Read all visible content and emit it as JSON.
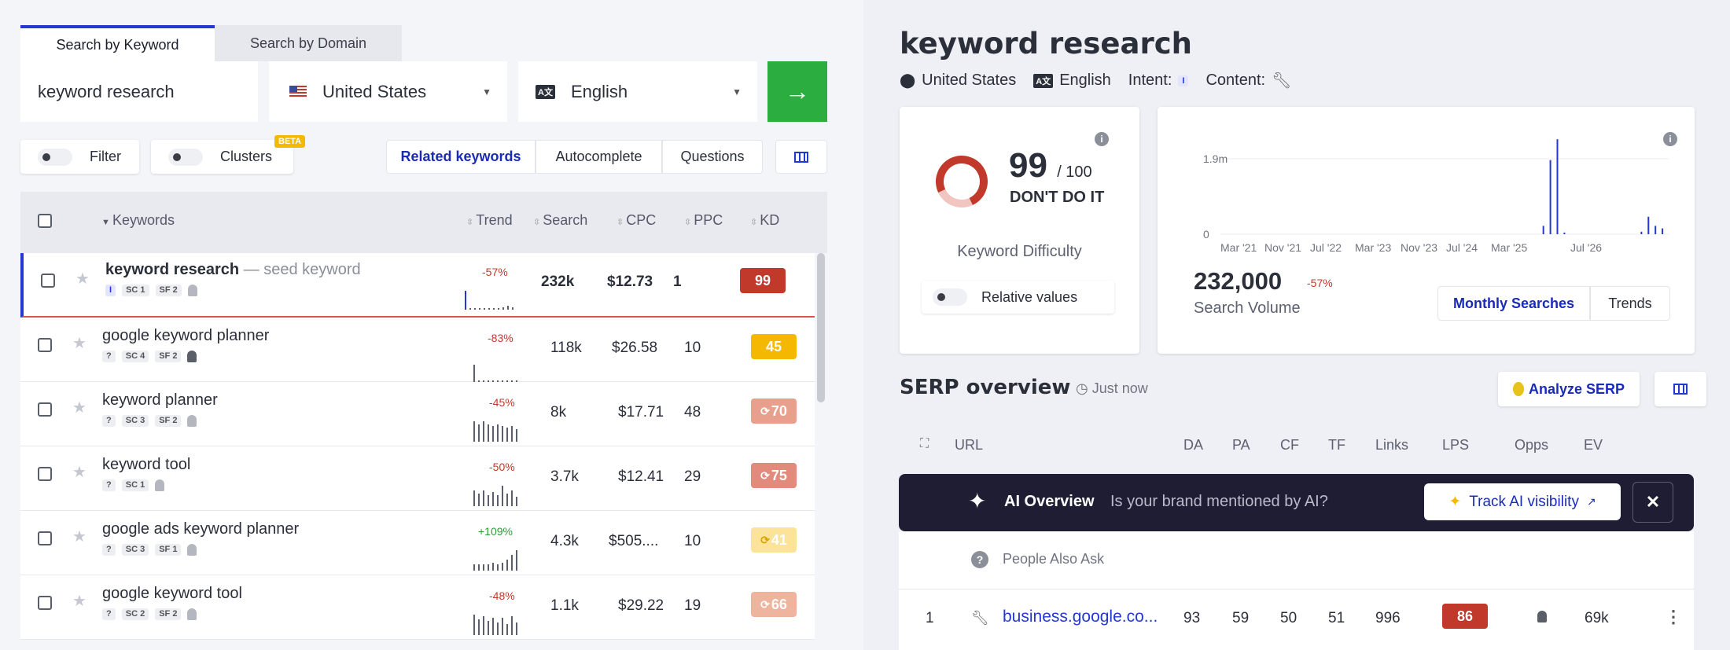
{
  "search": {
    "tab_keyword": "Search by Keyword",
    "tab_domain": "Search by Domain",
    "keyword_value": "keyword research",
    "country": "United States",
    "language": "English",
    "go_arrow": "→"
  },
  "filters": {
    "filter_label": "Filter",
    "clusters_label": "Clusters",
    "beta_badge": "BETA",
    "related": "Related keywords",
    "autocomplete": "Autocomplete",
    "questions": "Questions"
  },
  "table": {
    "headers": {
      "keywords": "Keywords",
      "trend": "Trend",
      "search": "Search",
      "cpc": "CPC",
      "ppc": "PPC",
      "kd": "KD"
    },
    "rows": [
      {
        "keyword": "keyword research",
        "suffix": " — seed keyword",
        "intent": "I",
        "sc": "SC 1",
        "sf": "SF 2",
        "trend": "-57%",
        "search": "232k",
        "cpc": "$12.73",
        "ppc": "1",
        "kd": "99"
      },
      {
        "keyword": "google keyword planner",
        "intent": "?",
        "sc": "SC 4",
        "sf": "SF 2",
        "trend": "-83%",
        "search": "118k",
        "cpc": "$26.58",
        "ppc": "10",
        "kd": "45"
      },
      {
        "keyword": "keyword planner",
        "intent": "?",
        "sc": "SC 3",
        "sf": "SF 2",
        "trend": "-45%",
        "search": "8k",
        "cpc": "$17.71",
        "ppc": "48",
        "kd": "70"
      },
      {
        "keyword": "keyword tool",
        "intent": "?",
        "sc": "SC 1",
        "sf": "",
        "trend": "-50%",
        "search": "3.7k",
        "cpc": "$12.41",
        "ppc": "29",
        "kd": "75"
      },
      {
        "keyword": "google ads keyword planner",
        "intent": "?",
        "sc": "SC 3",
        "sf": "SF 1",
        "trend": "+109%",
        "search": "4.3k",
        "cpc": "$505....",
        "ppc": "10",
        "kd": "41"
      },
      {
        "keyword": "google keyword tool",
        "intent": "?",
        "sc": "SC 2",
        "sf": "SF 2",
        "trend": "-48%",
        "search": "1.1k",
        "cpc": "$29.22",
        "ppc": "19",
        "kd": "66"
      }
    ]
  },
  "detail": {
    "title": "keyword research",
    "country": "United States",
    "language": "English",
    "intent_label": "Intent:",
    "intent_badge": "I",
    "content_label": "Content:",
    "kd_value": "99",
    "kd_max": "/ 100",
    "kd_verdict": "DON'T DO IT",
    "kd_caption": "Keyword Difficulty",
    "relative_values": "Relative values",
    "volume": "232,000",
    "volume_change": "-57%",
    "volume_caption": "Search Volume",
    "monthly_searches": "Monthly Searches",
    "trends": "Trends"
  },
  "chart_data": {
    "type": "bar",
    "y_ticks": [
      "1.9m",
      "0"
    ],
    "x_ticks": [
      "Mar '21",
      "Nov '21",
      "Jul '22",
      "Mar '23",
      "Nov '23",
      "Jul '24",
      "Mar '25",
      "Jul '26"
    ],
    "ylim": [
      0,
      2000000
    ],
    "values": [
      0,
      0,
      0,
      0,
      0,
      0,
      0,
      0,
      0,
      0,
      0,
      0,
      0,
      0,
      0,
      0,
      0,
      0,
      0,
      0,
      0,
      0,
      0,
      0,
      0,
      0,
      0,
      0,
      0,
      0,
      0,
      0,
      0,
      0,
      0,
      0,
      0,
      0,
      0,
      0,
      0,
      0,
      0,
      0,
      0,
      0,
      200000,
      1780000,
      2280000,
      40000,
      0,
      0,
      0,
      0,
      0,
      0,
      0,
      0,
      0,
      0,
      60000,
      420000,
      200000,
      140000
    ]
  },
  "serp": {
    "title": "SERP overview",
    "time": "Just now",
    "analyze": "Analyze SERP",
    "headers": {
      "url": "URL",
      "da": "DA",
      "pa": "PA",
      "cf": "CF",
      "tf": "TF",
      "links": "Links",
      "lps": "LPS",
      "opps": "Opps",
      "ev": "EV"
    },
    "ai_title": "AI Overview",
    "ai_question": "Is your brand mentioned by AI?",
    "ai_button": "Track AI visibility",
    "paa": "People Also Ask",
    "rows": [
      {
        "rank": "1",
        "url": "business.google.co...",
        "da": "93",
        "pa": "59",
        "cf": "50",
        "tf": "51",
        "links": "996",
        "lps": "86",
        "ev": "69k"
      }
    ]
  },
  "colors": {
    "accent": "#2437d0",
    "go": "#2bad3f",
    "kd_red": "#c0392b",
    "kd_yellow": "#f5b800"
  }
}
